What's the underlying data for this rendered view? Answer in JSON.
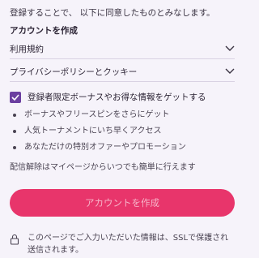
{
  "intro": "登録することで、 以下に同意したものとみなします。",
  "section_title": "アカウントを作成",
  "links": {
    "terms": "利用規約",
    "privacy": "プライバシーポリシーとクッキー"
  },
  "consent": {
    "label": "登録者限定ボーナスやお得な情報をゲットする",
    "checked": true
  },
  "bullets": [
    "ボーナスやフリースピンをさらにゲット",
    "人気トーナメントにいち早くアクセス",
    "あなただけの特別オファーやプロモーション"
  ],
  "unsubscribe_note": "配信解除はマイページからいつでも簡単に行えます",
  "cta_label": "アカウントを作成",
  "ssl_note": "このページでご入力いただいた情報は、SSLで保護され送信されます。",
  "colors": {
    "accent": "#e8356b",
    "checkbox": "#6b3fa0",
    "background": "#f6f3fa"
  },
  "icons": {
    "chevron": "chevron-down-icon",
    "check": "check-icon",
    "lock": "lock-icon"
  }
}
